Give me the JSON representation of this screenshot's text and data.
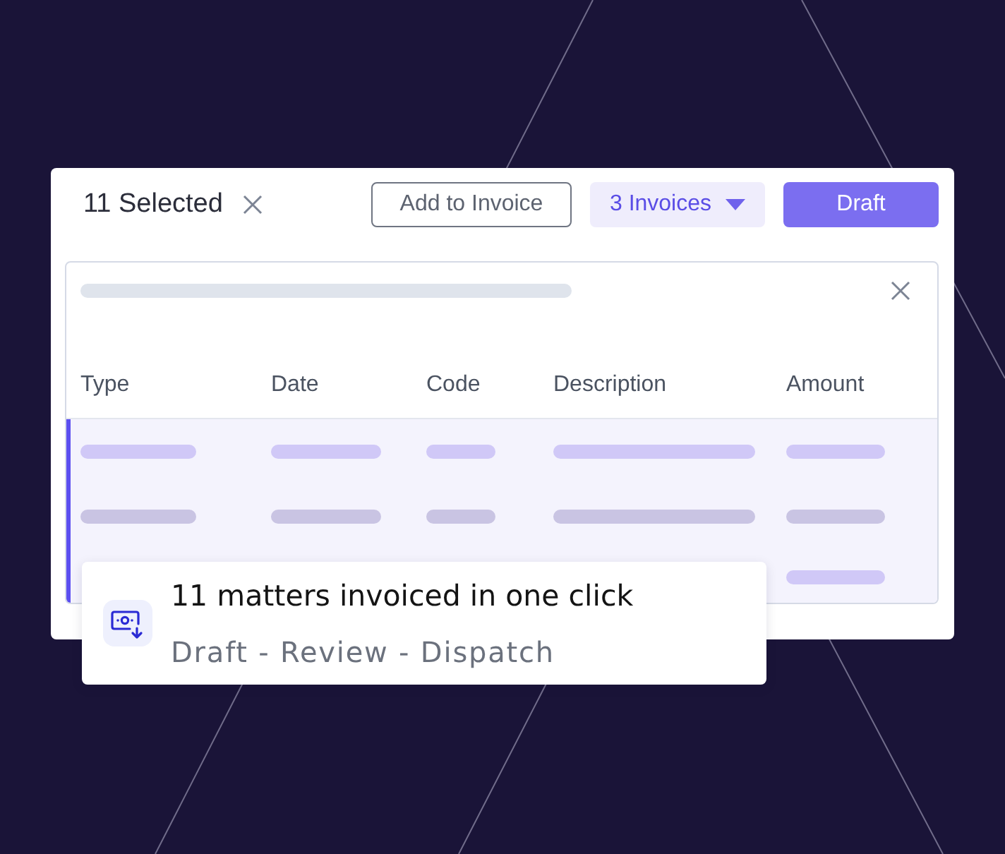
{
  "toolbar": {
    "selection_label": "11 Selected",
    "buttons": [
      {
        "label": "Add to Invoice",
        "kind": "outline"
      },
      {
        "label": "3 Invoices",
        "kind": "dropdown"
      },
      {
        "label": "Draft",
        "kind": "primary"
      }
    ]
  },
  "table": {
    "columns": [
      "Type",
      "Date",
      "Code",
      "Description",
      "Amount"
    ],
    "rows": [
      {
        "kind": "full",
        "selected": true
      },
      {
        "kind": "full",
        "selected": false
      },
      {
        "kind": "amount_only",
        "selected": true
      }
    ]
  },
  "toast": {
    "title": "11 matters invoiced in one click",
    "subtitle": "Draft - Review - Dispatch"
  }
}
